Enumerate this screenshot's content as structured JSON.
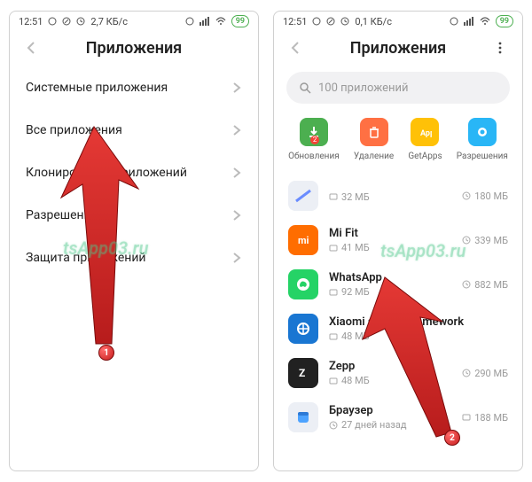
{
  "statusbar": {
    "time": "12:51",
    "net_speed": "2,7 КБ/с",
    "speed_r": "0,1 КБ/с",
    "battery": "99"
  },
  "left": {
    "title": "Приложения",
    "rows": [
      {
        "label": "Системные приложения"
      },
      {
        "label": "Все приложения"
      },
      {
        "label": "Клонирование приложений"
      },
      {
        "label": "Разрешения"
      },
      {
        "label": "Защита приложений"
      }
    ]
  },
  "right": {
    "title": "Приложения",
    "search_placeholder": "100 приложений",
    "quick": [
      {
        "icon": "update-icon",
        "label": "Обновления",
        "color": "#4CAF50",
        "badge": "2"
      },
      {
        "icon": "trash-icon",
        "label": "Удаление",
        "color": "#FF7043"
      },
      {
        "icon": "getapps-icon",
        "label": "GetApps",
        "color": "#FFC107"
      },
      {
        "icon": "perm-icon",
        "label": "Разрешения",
        "color": "#29B6F6"
      }
    ],
    "apps": [
      {
        "name": "",
        "size": "32 МБ",
        "clock": "180 МБ",
        "color": "#eceff5",
        "ic": "stripe"
      },
      {
        "name": "Mi Fit",
        "size": "41 МБ",
        "clock": "339 МБ",
        "color": "#FF6D00",
        "ic": "mi"
      },
      {
        "name": "WhatsApp",
        "size": "92 МБ",
        "clock": "882 МБ",
        "color": "#25D366",
        "ic": "wa"
      },
      {
        "name": "Xiaomi service framework",
        "size": "48 МБ",
        "clock": "",
        "color": "#1976D2",
        "ic": "xi"
      },
      {
        "name": "Zepp",
        "size": "48 МБ",
        "clock": "290 МБ",
        "color": "#212121",
        "ic": "zepp"
      },
      {
        "name": "Браузер",
        "size": "27 дней назад",
        "clock": "188 МБ",
        "color": "#eceff5",
        "ic": "browser"
      }
    ]
  },
  "annotations": {
    "step1": "1",
    "step2": "2",
    "watermark": "tsApp03.ru"
  }
}
